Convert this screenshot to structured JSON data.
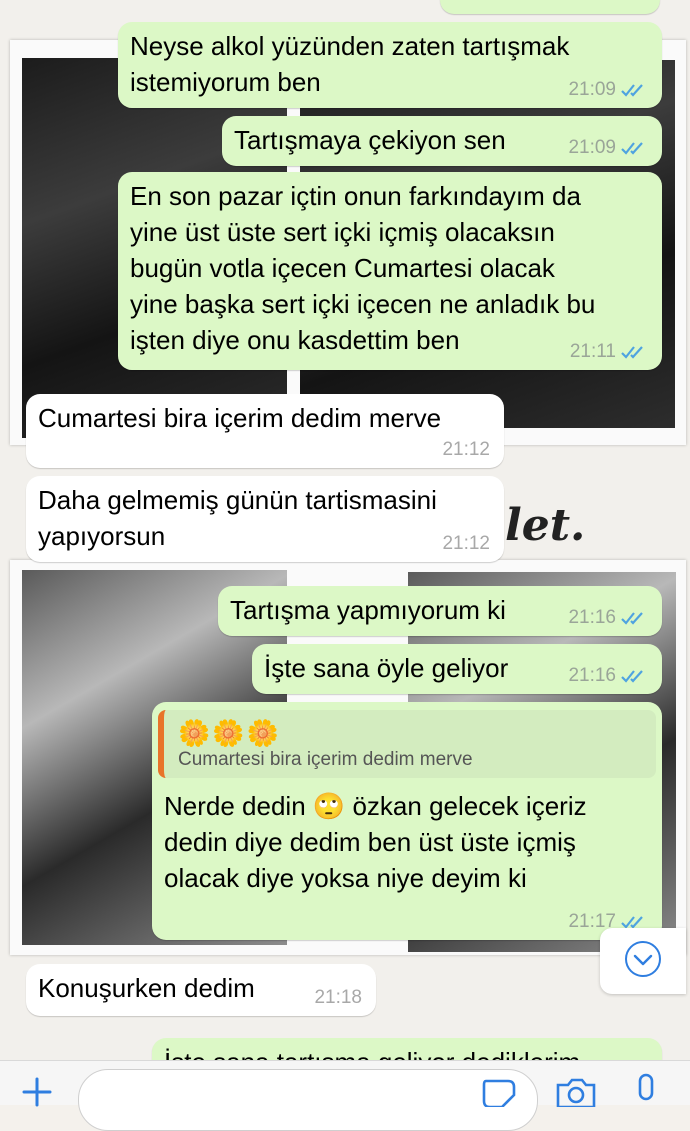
{
  "messages": [
    {
      "text": "Neyse alkol yüzünden zaten tartışmak\nistemiyorum ben",
      "time": "21:09",
      "dir": "out"
    },
    {
      "text": "Tartışmaya çekiyon sen",
      "time": "21:09",
      "dir": "out"
    },
    {
      "text": "En son pazar içtin onun farkındayım da\nyine üst üste sert içki içmiş olacaksın\nbugün votla içecen Cumartesi olacak\nyine başka sert içki içecen ne anladık bu\nişten diye onu kasdettim ben",
      "time": "21:11",
      "dir": "out"
    },
    {
      "text": "Cumartesi bira içerim dedim merve",
      "time": "21:12",
      "dir": "in"
    },
    {
      "text": "Daha gelmemiş günün tartismasini\nyapıyorsun",
      "time": "21:12",
      "dir": "in"
    },
    {
      "text": "Tartışma yapmıyorum ki",
      "time": "21:16",
      "dir": "out"
    },
    {
      "text": "İşte sana öyle geliyor",
      "time": "21:16",
      "dir": "out"
    },
    {
      "quote_emoji": "🌼🌼🌼",
      "quote_text": "Cumartesi bira içerim dedim merve",
      "text": "Nerde dedin 🙄 özkan gelecek içeriz\ndedin diye dedim ben üst üste içmiş\nolacak diye yoksa niye deyim ki",
      "time": "21:17",
      "dir": "out"
    },
    {
      "text": "Konuşurken dedim",
      "time": "21:18",
      "dir": "in"
    },
    {
      "text": "İşte sana tartışma geliyor dediklerim",
      "dir": "out"
    }
  ],
  "wallpaper": {
    "script_text": "let."
  },
  "colors": {
    "outgoing_bubble": "#dcf8c6",
    "incoming_bubble": "#ffffff",
    "read_ticks": "#4fa3e0",
    "quote_bar": "#e8742a",
    "accent": "#2f7ee0"
  },
  "icons": [
    "plus-icon",
    "sticker-icon",
    "camera-icon",
    "microphone-icon",
    "scroll-down-icon",
    "read-ticks-icon"
  ]
}
